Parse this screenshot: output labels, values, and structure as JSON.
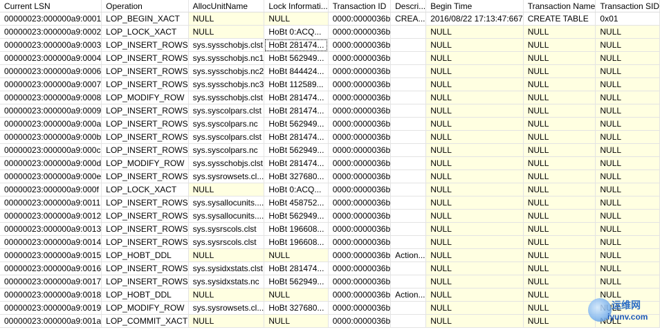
{
  "columns": [
    "Current LSN",
    "Operation",
    "AllocUnitName",
    "Lock Informati...",
    "Transaction ID",
    "Descri...",
    "Begin Time",
    "Transaction Name",
    "Transaction SID"
  ],
  "rows": [
    [
      "00000023:000000a9:0001",
      "LOP_BEGIN_XACT",
      "NULL",
      "NULL",
      "0000:0000036b",
      "CREA...",
      "2016/08/22 17:13:47:667",
      "CREATE TABLE",
      "0x01"
    ],
    [
      "00000023:000000a9:0002",
      "LOP_LOCK_XACT",
      "NULL",
      "HoBt 0:ACQ...",
      "0000:0000036b",
      "",
      "NULL",
      "NULL",
      "NULL"
    ],
    [
      "00000023:000000a9:0003",
      "LOP_INSERT_ROWS",
      "sys.sysschobjs.clst",
      "HoBt 281474...",
      "0000:0000036b",
      "",
      "NULL",
      "NULL",
      "NULL"
    ],
    [
      "00000023:000000a9:0004",
      "LOP_INSERT_ROWS",
      "sys.sysschobjs.nc1",
      "HoBt 562949...",
      "0000:0000036b",
      "",
      "NULL",
      "NULL",
      "NULL"
    ],
    [
      "00000023:000000a9:0006",
      "LOP_INSERT_ROWS",
      "sys.sysschobjs.nc2",
      "HoBt 844424...",
      "0000:0000036b",
      "",
      "NULL",
      "NULL",
      "NULL"
    ],
    [
      "00000023:000000a9:0007",
      "LOP_INSERT_ROWS",
      "sys.sysschobjs.nc3",
      "HoBt 112589...",
      "0000:0000036b",
      "",
      "NULL",
      "NULL",
      "NULL"
    ],
    [
      "00000023:000000a9:0008",
      "LOP_MODIFY_ROW",
      "sys.sysschobjs.clst",
      "HoBt 281474...",
      "0000:0000036b",
      "",
      "NULL",
      "NULL",
      "NULL"
    ],
    [
      "00000023:000000a9:0009",
      "LOP_INSERT_ROWS",
      "sys.syscolpars.clst",
      "HoBt 281474...",
      "0000:0000036b",
      "",
      "NULL",
      "NULL",
      "NULL"
    ],
    [
      "00000023:000000a9:000a",
      "LOP_INSERT_ROWS",
      "sys.syscolpars.nc",
      "HoBt 562949...",
      "0000:0000036b",
      "",
      "NULL",
      "NULL",
      "NULL"
    ],
    [
      "00000023:000000a9:000b",
      "LOP_INSERT_ROWS",
      "sys.syscolpars.clst",
      "HoBt 281474...",
      "0000:0000036b",
      "",
      "NULL",
      "NULL",
      "NULL"
    ],
    [
      "00000023:000000a9:000c",
      "LOP_INSERT_ROWS",
      "sys.syscolpars.nc",
      "HoBt 562949...",
      "0000:0000036b",
      "",
      "NULL",
      "NULL",
      "NULL"
    ],
    [
      "00000023:000000a9:000d",
      "LOP_MODIFY_ROW",
      "sys.sysschobjs.clst",
      "HoBt 281474...",
      "0000:0000036b",
      "",
      "NULL",
      "NULL",
      "NULL"
    ],
    [
      "00000023:000000a9:000e",
      "LOP_INSERT_ROWS",
      "sys.sysrowsets.cl...",
      "HoBt 327680...",
      "0000:0000036b",
      "",
      "NULL",
      "NULL",
      "NULL"
    ],
    [
      "00000023:000000a9:000f",
      "LOP_LOCK_XACT",
      "NULL",
      "HoBt 0:ACQ...",
      "0000:0000036b",
      "",
      "NULL",
      "NULL",
      "NULL"
    ],
    [
      "00000023:000000a9:0011",
      "LOP_INSERT_ROWS",
      "sys.sysallocunits....",
      "HoBt 458752...",
      "0000:0000036b",
      "",
      "NULL",
      "NULL",
      "NULL"
    ],
    [
      "00000023:000000a9:0012",
      "LOP_INSERT_ROWS",
      "sys.sysallocunits....",
      "HoBt 562949...",
      "0000:0000036b",
      "",
      "NULL",
      "NULL",
      "NULL"
    ],
    [
      "00000023:000000a9:0013",
      "LOP_INSERT_ROWS",
      "sys.sysrscols.clst",
      "HoBt 196608...",
      "0000:0000036b",
      "",
      "NULL",
      "NULL",
      "NULL"
    ],
    [
      "00000023:000000a9:0014",
      "LOP_INSERT_ROWS",
      "sys.sysrscols.clst",
      "HoBt 196608...",
      "0000:0000036b",
      "",
      "NULL",
      "NULL",
      "NULL"
    ],
    [
      "00000023:000000a9:0015",
      "LOP_HOBT_DDL",
      "NULL",
      "NULL",
      "0000:0000036b",
      "Action...",
      "NULL",
      "NULL",
      "NULL"
    ],
    [
      "00000023:000000a9:0016",
      "LOP_INSERT_ROWS",
      "sys.sysidxstats.clst",
      "HoBt 281474...",
      "0000:0000036b",
      "",
      "NULL",
      "NULL",
      "NULL"
    ],
    [
      "00000023:000000a9:0017",
      "LOP_INSERT_ROWS",
      "sys.sysidxstats.nc",
      "HoBt 562949...",
      "0000:0000036b",
      "",
      "NULL",
      "NULL",
      "NULL"
    ],
    [
      "00000023:000000a9:0018",
      "LOP_HOBT_DDL",
      "NULL",
      "NULL",
      "0000:0000036b",
      "Action...",
      "NULL",
      "NULL",
      "NULL"
    ],
    [
      "00000023:000000a9:0019",
      "LOP_MODIFY_ROW",
      "sys.sysrowsets.cl...",
      "HoBt 327680...",
      "0000:0000036b",
      "",
      "NULL",
      "NULL",
      "NULL"
    ],
    [
      "00000023:000000a9:001a",
      "LOP_COMMIT_XACT",
      "NULL",
      "NULL",
      "0000:0000036b",
      "",
      "NULL",
      "NULL",
      "NULL"
    ]
  ],
  "selected_cell": {
    "row": 2,
    "col": 3
  },
  "watermark": {
    "name": "运维网",
    "url": "iyunv.com"
  },
  "colors": {
    "null_cell": "#ffffe1",
    "grid_line": "#e3e3e3"
  }
}
